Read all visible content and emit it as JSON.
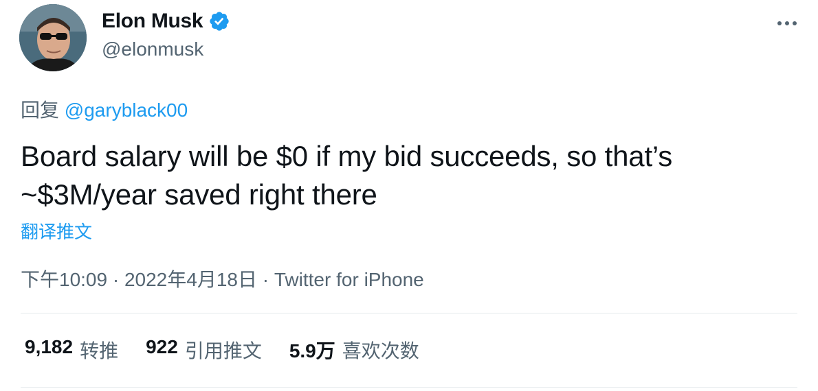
{
  "author": {
    "display_name": "Elon Musk",
    "handle": "@elonmusk",
    "verified": true,
    "verified_color": "#1d9bf0"
  },
  "more_icon": "more-horizontal-icon",
  "reply": {
    "prefix": "回复",
    "mention": "@garyblack00"
  },
  "tweet": {
    "text": "Board salary will be $0 if my bid succeeds, so that’s ~$3M/year saved right there",
    "translate_label": "翻译推文"
  },
  "meta": {
    "time": "下午10:09",
    "date": "2022年4月18日",
    "source": "Twitter for iPhone",
    "separator": "·"
  },
  "stats": [
    {
      "count": "9,182",
      "label": "转推"
    },
    {
      "count": "922",
      "label": "引用推文"
    },
    {
      "count": "5.9万",
      "label": "喜欢次数"
    }
  ],
  "colors": {
    "text": "#0f1419",
    "secondary": "#536471",
    "link": "#1d9bf0",
    "divider": "#e5eaec"
  }
}
